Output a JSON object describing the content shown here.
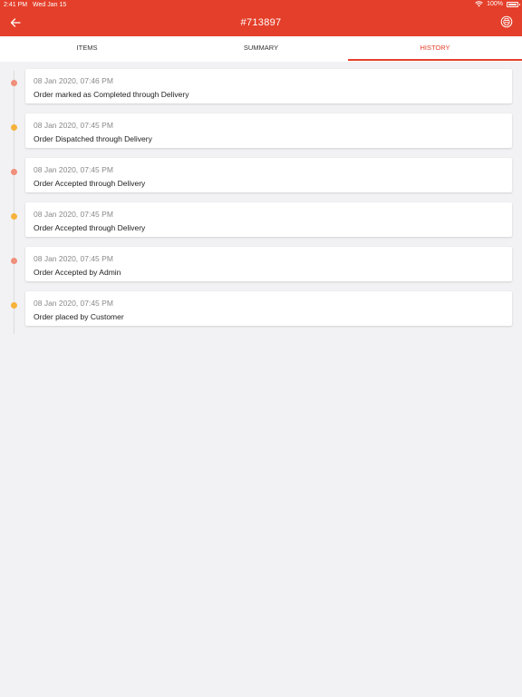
{
  "status_bar": {
    "time": "2:41 PM",
    "date": "Wed Jan 15",
    "battery": "100%"
  },
  "header": {
    "title": "#713897",
    "back_icon": "arrow-left-icon",
    "print_icon": "printer-icon"
  },
  "tabs": [
    {
      "label": "ITEMS",
      "active": false
    },
    {
      "label": "SUMMARY",
      "active": false
    },
    {
      "label": "HISTORY",
      "active": true
    }
  ],
  "history": [
    {
      "time": "08 Jan 2020, 07:46 PM",
      "description": "Order marked as Completed through Delivery",
      "dot_color": "#f0907c"
    },
    {
      "time": "08 Jan 2020, 07:45 PM",
      "description": "Order Dispatched through Delivery",
      "dot_color": "#f7b23b"
    },
    {
      "time": "08 Jan 2020, 07:45 PM",
      "description": "Order Accepted through Delivery",
      "dot_color": "#f0907c"
    },
    {
      "time": "08 Jan 2020, 07:45 PM",
      "description": "Order Accepted through Delivery",
      "dot_color": "#f7b23b"
    },
    {
      "time": "08 Jan 2020, 07:45 PM",
      "description": "Order Accepted by Admin",
      "dot_color": "#f0907c"
    },
    {
      "time": "08 Jan 2020, 07:45 PM",
      "description": "Order placed by Customer",
      "dot_color": "#f7b23b"
    }
  ],
  "colors": {
    "accent": "#e43f2a",
    "background": "#f2f2f4"
  }
}
